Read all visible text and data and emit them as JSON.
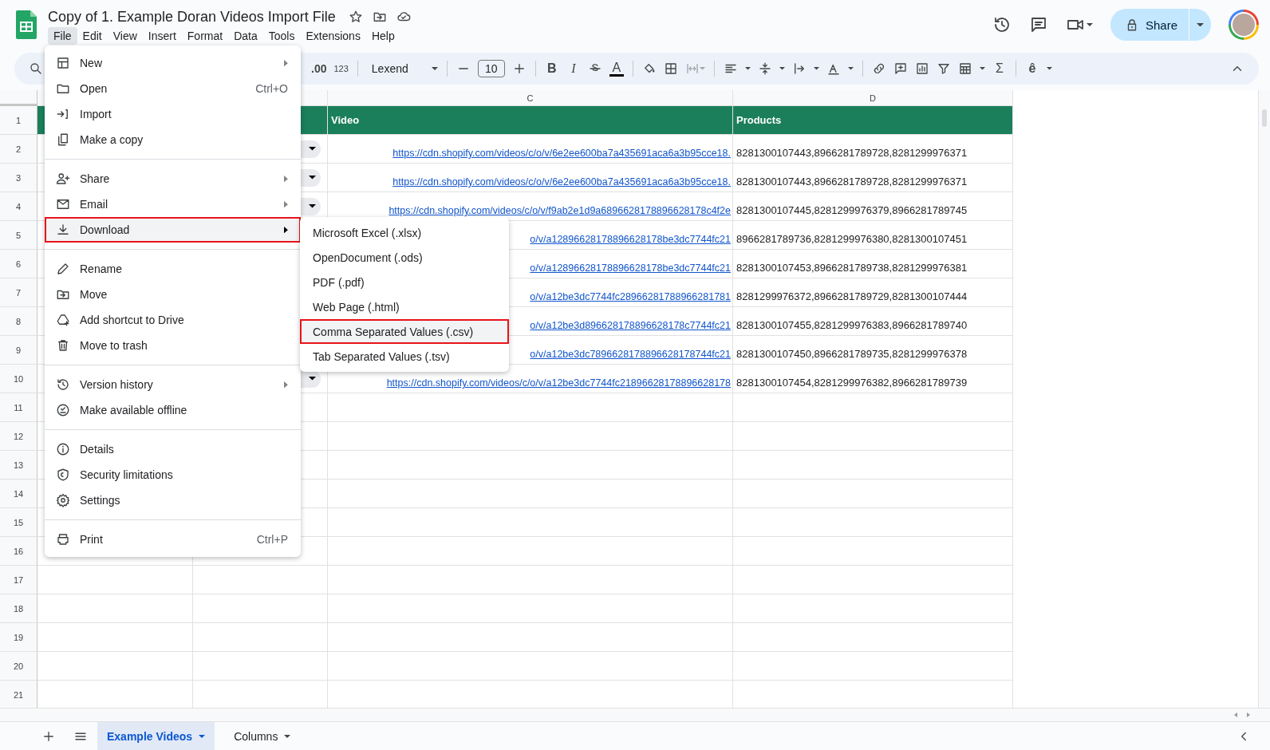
{
  "app": {
    "title": "Copy of 1. Example Doran Videos Import File",
    "menu": [
      {
        "label": "File",
        "selected": true
      },
      {
        "label": "Edit",
        "selected": false
      },
      {
        "label": "View",
        "selected": false
      },
      {
        "label": "Insert",
        "selected": false
      },
      {
        "label": "Format",
        "selected": false
      },
      {
        "label": "Data",
        "selected": false
      },
      {
        "label": "Tools",
        "selected": false
      },
      {
        "label": "Extensions",
        "selected": false
      },
      {
        "label": "Help",
        "selected": false
      }
    ]
  },
  "share_button": {
    "label": "Share"
  },
  "toolbar": {
    "decimal_format": ".00",
    "number_format": "123",
    "font": "Lexend",
    "font_size": "10",
    "bold": "B",
    "italic": "I",
    "text_color": "A",
    "functions": "Σ",
    "input_tools": "ê"
  },
  "sheet": {
    "columns": [
      "C",
      "D"
    ],
    "row_numbers": [
      "1",
      "2",
      "3",
      "4",
      "5",
      "6",
      "7",
      "8",
      "9",
      "10",
      "11",
      "12",
      "13",
      "14",
      "15",
      "16",
      "17",
      "18",
      "19",
      "20",
      "21"
    ],
    "header": {
      "video": "Video",
      "products": "Products"
    },
    "rows": [
      {
        "dropdown": true,
        "video": "https://cdn.shopify.com/videos/c/o/v/6e2ee600ba7a435691aca6a3b95cce18.",
        "products": "8281300107443,8966281789728,8281299976371"
      },
      {
        "dropdown": true,
        "video": "https://cdn.shopify.com/videos/c/o/v/6e2ee600ba7a435691aca6a3b95cce18.",
        "products": "8281300107443,8966281789728,8281299976371"
      },
      {
        "dropdown": true,
        "video": "https://cdn.shopify.com/videos/c/o/v/f9ab2e1d9a6896628178896628178c4f2e",
        "products": "8281300107445,8281299976379,8966281789745"
      },
      {
        "dropdown": false,
        "video": "o/v/a12896628178896628178be3dc7744fc21",
        "products": "8966281789736,8281299976380,8281300107451"
      },
      {
        "dropdown": false,
        "video": "o/v/a12896628178896628178be3dc7744fc21",
        "products": "8281300107453,8966281789738,8281299976381"
      },
      {
        "dropdown": false,
        "video": "o/v/a12be3dc7744fc28966281788966281781",
        "products": "8281299976372,8966281789729,8281300107444"
      },
      {
        "dropdown": false,
        "video": "o/v/a12be3d896628178896628178c7744fc21",
        "products": "8281300107455,8281299976383,8966281789740"
      },
      {
        "dropdown": false,
        "video": "o/v/a12be3dc7896628178896628178744fc21",
        "products": "8281300107450,8966281789735,8281299976378"
      },
      {
        "dropdown": true,
        "video": "https://cdn.shopify.com/videos/c/o/v/a12be3dc7744fc21896628178896628178",
        "products": "8281300107454,8281299976382,8966281789739"
      }
    ]
  },
  "file_menu": {
    "sections": [
      {
        "items": [
          {
            "label": "New",
            "submenu": true,
            "selected": false
          },
          {
            "label": "Open",
            "shortcut": "Ctrl+O",
            "submenu": false,
            "selected": false
          },
          {
            "label": "Import",
            "submenu": false,
            "selected": false
          },
          {
            "label": "Make a copy",
            "submenu": false,
            "selected": false
          }
        ]
      },
      {
        "items": [
          {
            "label": "Share",
            "submenu": true,
            "selected": false
          },
          {
            "label": "Email",
            "submenu": true,
            "selected": false
          },
          {
            "label": "Download",
            "submenu": true,
            "selected": true
          }
        ]
      },
      {
        "items": [
          {
            "label": "Rename",
            "submenu": false,
            "selected": false
          },
          {
            "label": "Move",
            "submenu": false,
            "selected": false
          },
          {
            "label": "Add shortcut to Drive",
            "submenu": false,
            "selected": false
          },
          {
            "label": "Move to trash",
            "submenu": false,
            "selected": false
          }
        ]
      },
      {
        "items": [
          {
            "label": "Version history",
            "submenu": true,
            "selected": false
          },
          {
            "label": "Make available offline",
            "submenu": false,
            "selected": false
          }
        ]
      },
      {
        "items": [
          {
            "label": "Details",
            "submenu": false,
            "selected": false
          },
          {
            "label": "Security limitations",
            "submenu": false,
            "selected": false
          },
          {
            "label": "Settings",
            "submenu": false,
            "selected": false
          }
        ]
      },
      {
        "items": [
          {
            "label": "Print",
            "shortcut": "Ctrl+P",
            "submenu": false,
            "selected": false
          }
        ]
      }
    ]
  },
  "download_submenu": {
    "items": [
      {
        "label": "Microsoft Excel (.xlsx)",
        "selected": false
      },
      {
        "label": "OpenDocument (.ods)",
        "selected": false
      },
      {
        "label": "PDF (.pdf)",
        "selected": false
      },
      {
        "label": "Web Page (.html)",
        "selected": false
      },
      {
        "label": "Comma Separated Values (.csv)",
        "selected": true
      },
      {
        "label": "Tab Separated Values (.tsv)",
        "selected": false
      }
    ]
  },
  "sheet_tabs": [
    {
      "label": "Example Videos",
      "selected": true
    },
    {
      "label": "Columns",
      "selected": false
    }
  ]
}
